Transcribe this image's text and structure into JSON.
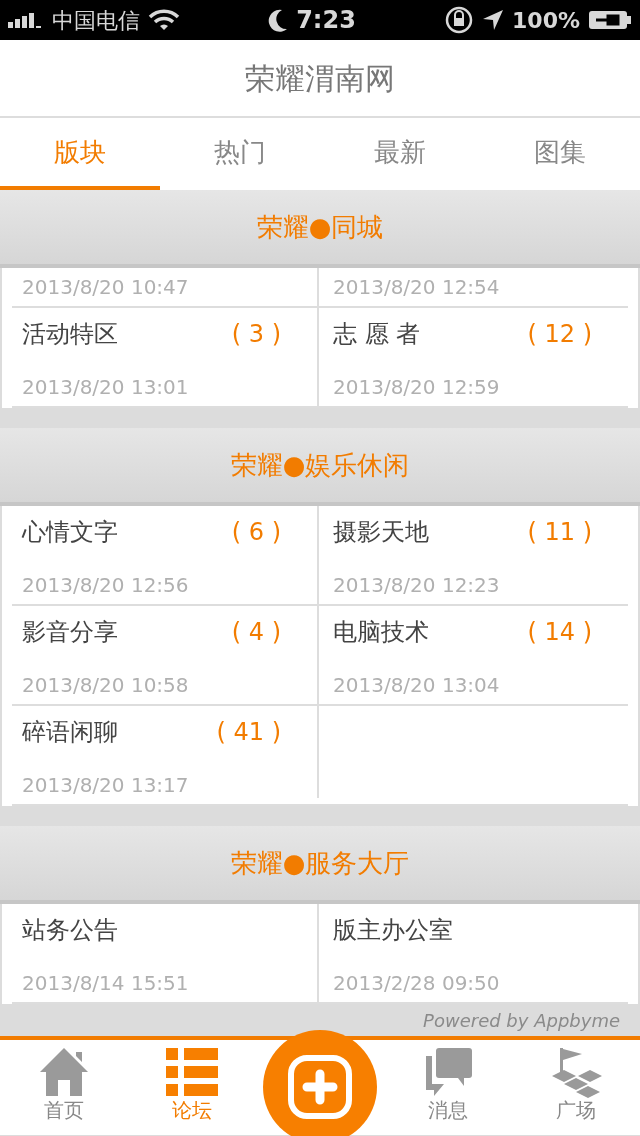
{
  "status_bar": {
    "carrier": "中国电信",
    "time": "7:23",
    "battery": "100%"
  },
  "header": {
    "title": "荣耀渭南网"
  },
  "tabs": [
    {
      "label": "版块",
      "selected": true
    },
    {
      "label": "热门",
      "selected": false
    },
    {
      "label": "最新",
      "selected": false
    },
    {
      "label": "图集",
      "selected": false
    }
  ],
  "sections": [
    {
      "title": "荣耀●同城",
      "rows": [
        [
          {
            "date": "2013/8/20 10:47"
          },
          {
            "date": "2013/8/20 12:54"
          }
        ],
        [
          {
            "name": "活动特区",
            "count": "( 3 )",
            "date": "2013/8/20 13:01"
          },
          {
            "name": "志 愿 者",
            "count": "( 12 )",
            "date": "2013/8/20 12:59"
          }
        ]
      ]
    },
    {
      "title": "荣耀●娱乐休闲",
      "rows": [
        [
          {
            "name": "心情文字",
            "count": "( 6 )",
            "date": "2013/8/20 12:56"
          },
          {
            "name": "摄影天地",
            "count": "( 11 )",
            "date": "2013/8/20 12:23"
          }
        ],
        [
          {
            "name": "影音分享",
            "count": "( 4 )",
            "date": "2013/8/20 10:58"
          },
          {
            "name": "电脑技术",
            "count": "( 14 )",
            "date": "2013/8/20 13:04"
          }
        ],
        [
          {
            "name": "碎语闲聊",
            "count": "( 41 )",
            "date": "2013/8/20 13:17"
          }
        ]
      ]
    },
    {
      "title": "荣耀●服务大厅",
      "rows": [
        [
          {
            "name": "站务公告",
            "date": "2013/8/14 15:51"
          },
          {
            "name": "版主办公室",
            "date": "2013/2/28 09:50"
          }
        ]
      ]
    }
  ],
  "footer": {
    "powered_by": "Powered by Appbyme"
  },
  "bottom_nav": [
    {
      "kind": "tab",
      "label": "首页",
      "selected": false
    },
    {
      "kind": "tab",
      "label": "论坛",
      "selected": true
    },
    {
      "kind": "center"
    },
    {
      "kind": "tab",
      "label": "消息",
      "selected": false
    },
    {
      "kind": "tab",
      "label": "广场",
      "selected": false
    }
  ]
}
